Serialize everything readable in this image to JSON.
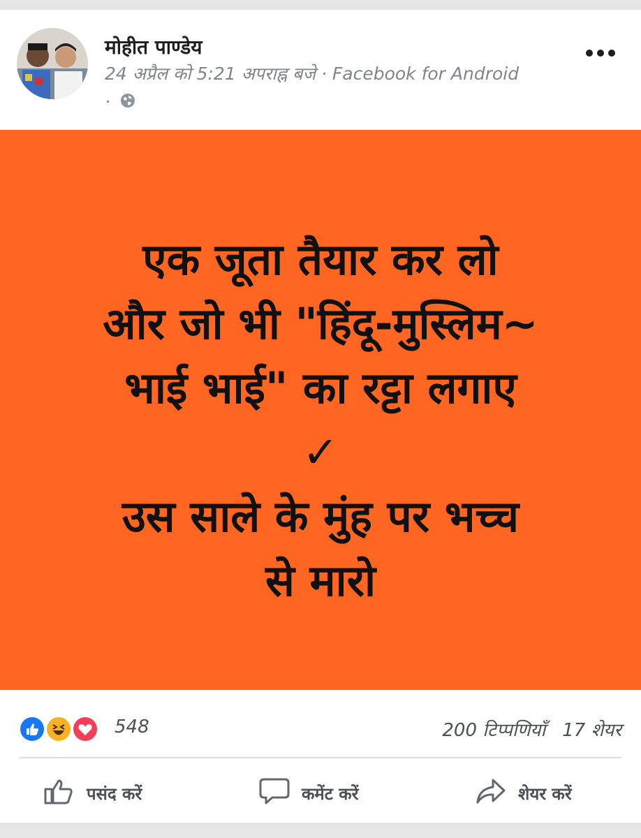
{
  "post": {
    "author": "मोहीत पाण्डेय",
    "timestamp": "24 अप्रैल को 5:21 अपराह्न बजे",
    "separator": "·",
    "source": "Facebook for Android",
    "audience_icon": "globe-icon",
    "more_icon": "more-options-icon"
  },
  "image": {
    "background_color": "#fe6621",
    "text_color": "#111111",
    "lines": [
      "एक जूता तैयार कर लो",
      "और जो भी \"हिंदू-मुस्लिम~",
      "भाई भाई\" का रट्टा लगाए",
      "✓",
      "उस साले के मुंह पर भच्च",
      "से मारो"
    ]
  },
  "stats": {
    "reactions": [
      "like",
      "haha",
      "love"
    ],
    "reaction_count": "548",
    "comments": "200 टिप्पणियाँ",
    "shares": "17 शेयर"
  },
  "actions": {
    "like": "पसंद करें",
    "comment": "कमेंट करें",
    "share": "शेयर करें"
  }
}
